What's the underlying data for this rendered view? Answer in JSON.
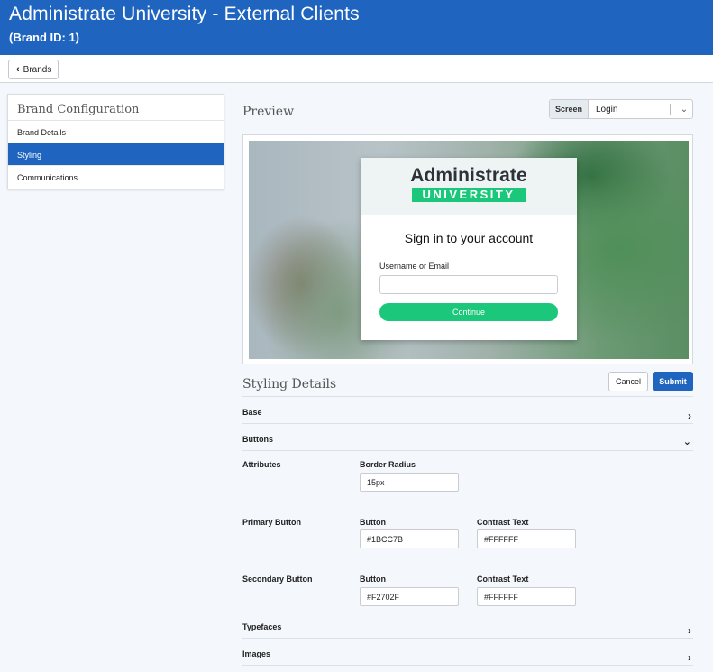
{
  "header": {
    "title": "Administrate University - External Clients",
    "subtitle": "(Brand ID: 1)"
  },
  "toolbar": {
    "back_label": "Brands"
  },
  "sidebar": {
    "heading": "Brand Configuration",
    "items": [
      {
        "label": "Brand Details"
      },
      {
        "label": "Styling",
        "active": true
      },
      {
        "label": "Communications"
      }
    ]
  },
  "preview": {
    "title": "Preview",
    "screen_label": "Screen",
    "screen_value": "Login",
    "login_card": {
      "logo_top": "Administrate",
      "logo_bottom": "UNIVERSITY",
      "heading": "Sign in to your account",
      "field_label": "Username or Email",
      "button_label": "Continue"
    }
  },
  "styling": {
    "title": "Styling Details",
    "cancel_label": "Cancel",
    "submit_label": "Submit",
    "sections": {
      "base": "Base",
      "buttons": "Buttons",
      "typefaces": "Typefaces",
      "images": "Images"
    },
    "attributes": {
      "label": "Attributes",
      "border_radius_label": "Border Radius",
      "border_radius_value": "15px"
    },
    "primary": {
      "label": "Primary Button",
      "button_label": "Button",
      "button_value": "#1BCC7B",
      "contrast_label": "Contrast Text",
      "contrast_value": "#FFFFFF"
    },
    "secondary": {
      "label": "Secondary Button",
      "button_label": "Button",
      "button_value": "#F2702F",
      "contrast_label": "Contrast Text",
      "contrast_value": "#FFFFFF"
    }
  },
  "colors": {
    "brand_blue": "#1f65c0",
    "login_green": "#1bc77b"
  }
}
